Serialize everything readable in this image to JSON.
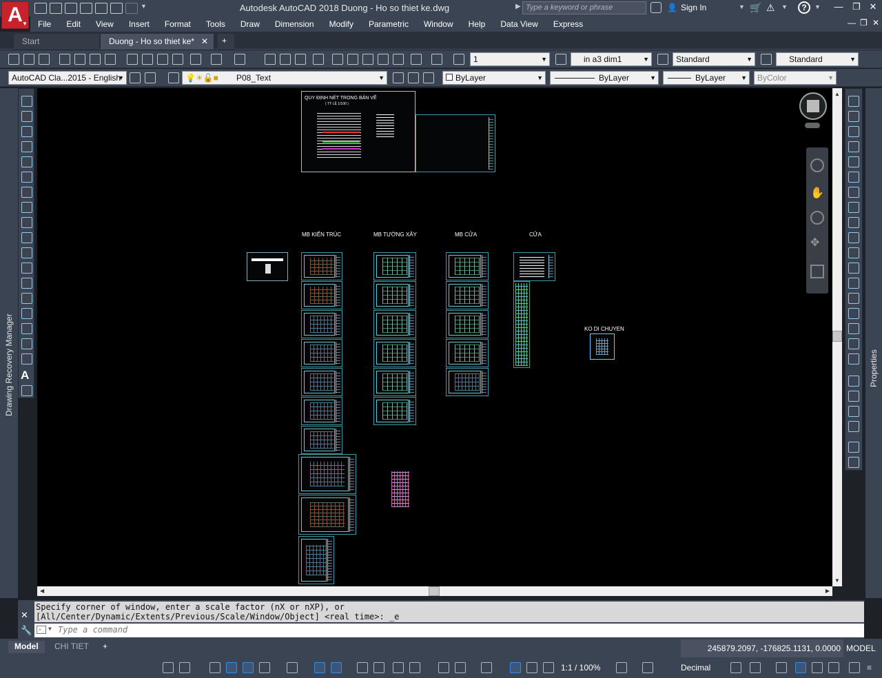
{
  "app": {
    "logo_letter": "A",
    "window_title": "Autodesk AutoCAD 2018   Duong - Ho so thiet ke.dwg",
    "search_placeholder": "Type a keyword or phrase",
    "sign_in": "Sign In"
  },
  "menu": [
    "File",
    "Edit",
    "View",
    "Insert",
    "Format",
    "Tools",
    "Draw",
    "Dimension",
    "Modify",
    "Parametric",
    "Window",
    "Help",
    "Data View",
    "Express"
  ],
  "tabs": [
    {
      "label": "Start"
    },
    {
      "label": "Duong - Ho so thiet ke*"
    }
  ],
  "toolbar1": {
    "text_height": "1",
    "dim_style": "in a3 dim1",
    "table_style": "Standard",
    "multileader_style": "Standard"
  },
  "toolbar2": {
    "workspace": "AutoCAD Cla...2015 - English",
    "layer": "P08_Text",
    "color": "ByLayer",
    "linetype": "ByLayer",
    "lineweight": "ByLayer",
    "plot_style": "ByColor"
  },
  "canvas_labels": {
    "legend_title": "QUY ĐỊNH NÉT TRONG BẢN VẼ",
    "legend_sub": "( TỶ LỆ 1/100 )",
    "col_kien_truc": "MB KIẾN TRÚC",
    "col_tuong_xay": "MB TƯỜNG XÂY",
    "col_cua": "MB CỬA",
    "col_cua2": "CỬA",
    "ko_di_chuyen": "KO DI CHUYEN"
  },
  "palettes": {
    "left": "Drawing Recovery Manager",
    "right": "Properties"
  },
  "command": {
    "history_line1": "Specify corner of window, enter a scale factor (nX or nXP), or",
    "history_line2": "[All/Center/Dynamic/Extents/Previous/Scale/Window/Object] <real time>: _e",
    "input_placeholder": "Type a command"
  },
  "layout_tabs": [
    "Model",
    "CHI TIET"
  ],
  "status": {
    "coordinates": "245879.2097, -176825.1131, 0.0000",
    "space": "MODEL",
    "annotation_scale": "1:1 / 100%",
    "units": "Decimal"
  },
  "colors": {
    "chrome": "#3b4453",
    "canvas": "#000000",
    "sheet_border": "#3e9aa3",
    "accent": "#3b8de0",
    "logo": "#c8232c"
  }
}
